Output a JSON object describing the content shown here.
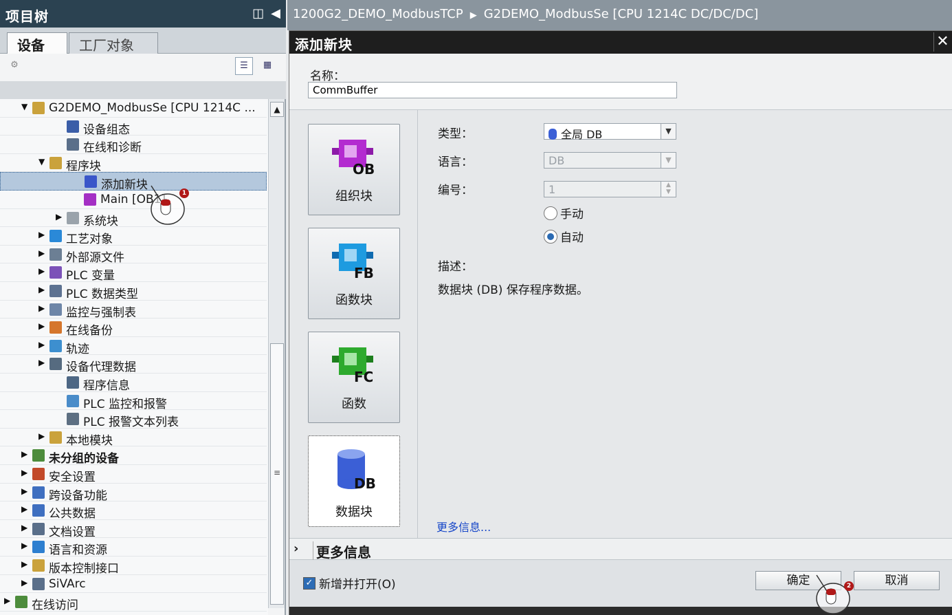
{
  "tree": {
    "title": "项目树",
    "tabs": [
      "设备",
      "工厂对象"
    ],
    "items": [
      {
        "label": "G2DEMO_ModbusSe [CPU 1214C ...",
        "indent": 1,
        "arrow": "▼",
        "color": "#caa23c",
        "bold": false
      },
      {
        "label": "设备组态",
        "indent": 3,
        "arrow": "",
        "color": "#3b5ea8",
        "bold": false
      },
      {
        "label": "在线和诊断",
        "indent": 3,
        "arrow": "",
        "color": "#5a6f8a",
        "bold": false
      },
      {
        "label": "程序块",
        "indent": 2,
        "arrow": "▼",
        "color": "#caa23c",
        "bold": false
      },
      {
        "label": "添加新块",
        "indent": 4,
        "arrow": "",
        "color": "#3a56c9",
        "bold": false,
        "selected": true
      },
      {
        "label": "Main [OB1]",
        "indent": 4,
        "arrow": "",
        "color": "#a42fc4",
        "bold": false
      },
      {
        "label": "系统块",
        "indent": 3,
        "arrow": "▶",
        "color": "#9aa3ab",
        "bold": false
      },
      {
        "label": "工艺对象",
        "indent": 2,
        "arrow": "▶",
        "color": "#2a89d8",
        "bold": false
      },
      {
        "label": "外部源文件",
        "indent": 2,
        "arrow": "▶",
        "color": "#6c7f94",
        "bold": false
      },
      {
        "label": "PLC 变量",
        "indent": 2,
        "arrow": "▶",
        "color": "#7c52b8",
        "bold": false
      },
      {
        "label": "PLC 数据类型",
        "indent": 2,
        "arrow": "▶",
        "color": "#5d7291",
        "bold": false
      },
      {
        "label": "监控与强制表",
        "indent": 2,
        "arrow": "▶",
        "color": "#6e86a8",
        "bold": false
      },
      {
        "label": "在线备份",
        "indent": 2,
        "arrow": "▶",
        "color": "#d5762c",
        "bold": false
      },
      {
        "label": "轨迹",
        "indent": 2,
        "arrow": "▶",
        "color": "#3d8fcf",
        "bold": false
      },
      {
        "label": "设备代理数据",
        "indent": 2,
        "arrow": "▶",
        "color": "#566b80",
        "bold": false
      },
      {
        "label": "程序信息",
        "indent": 3,
        "arrow": "",
        "color": "#4d6784",
        "bold": false
      },
      {
        "label": "PLC 监控和报警",
        "indent": 3,
        "arrow": "",
        "color": "#4a8cc9",
        "bold": false
      },
      {
        "label": "PLC 报警文本列表",
        "indent": 3,
        "arrow": "",
        "color": "#5d6f82",
        "bold": false
      },
      {
        "label": "本地模块",
        "indent": 2,
        "arrow": "▶",
        "color": "#caa23c",
        "bold": false
      },
      {
        "label": "未分组的设备",
        "indent": 1,
        "arrow": "▶",
        "color": "#4d8c3c",
        "bold": true
      },
      {
        "label": "安全设置",
        "indent": 1,
        "arrow": "▶",
        "color": "#c24a2a",
        "bold": false
      },
      {
        "label": "跨设备功能",
        "indent": 1,
        "arrow": "▶",
        "color": "#3f6fc0",
        "bold": false
      },
      {
        "label": "公共数据",
        "indent": 1,
        "arrow": "▶",
        "color": "#3f6fc0",
        "bold": false
      },
      {
        "label": "文档设置",
        "indent": 1,
        "arrow": "▶",
        "color": "#5a6f8a",
        "bold": false
      },
      {
        "label": "语言和资源",
        "indent": 1,
        "arrow": "▶",
        "color": "#2d7fd0",
        "bold": false
      },
      {
        "label": "版本控制接口",
        "indent": 1,
        "arrow": "▶",
        "color": "#caa23c",
        "bold": false
      },
      {
        "label": "SiVArc",
        "indent": 1,
        "arrow": "▶",
        "color": "#5a6f8a",
        "bold": false
      },
      {
        "label": "在线访问",
        "indent": 0,
        "arrow": "▶",
        "color": "#4d8c3c",
        "bold": false
      }
    ]
  },
  "editor": {
    "breadcrumb": [
      "1200G2_DEMO_ModbusTCP",
      "G2DEMO_ModbusSe [CPU 1214C DC/DC/DC]"
    ]
  },
  "dialog": {
    "title": "添加新块",
    "close": "✕",
    "name_label": "名称：",
    "name_value": "CommBuffer",
    "blocks": [
      {
        "code": "OB",
        "label": "组织块",
        "color": "#b32bd0"
      },
      {
        "code": "FB",
        "label": "函数块",
        "color": "#1e9be0"
      },
      {
        "code": "FC",
        "label": "函数",
        "color": "#2eaa2e"
      },
      {
        "code": "DB",
        "label": "数据块",
        "color": "#3b5fd6"
      }
    ],
    "type_label": "类型：",
    "type_value": "全局 DB",
    "language_label": "语言：",
    "language_value": "DB",
    "number_label": "编号：",
    "number_value": "1",
    "radio_manual": "手动",
    "radio_auto": "自动",
    "desc_label": "描述：",
    "desc_text": "数据块 (DB) 保存程序数据。",
    "more_link": "更多信息...",
    "more_info_bar": "更多信息",
    "checkbox_label": "新增并打开(O)",
    "ok": "确定",
    "cancel": "取消"
  },
  "markers": [
    "1",
    "2"
  ]
}
